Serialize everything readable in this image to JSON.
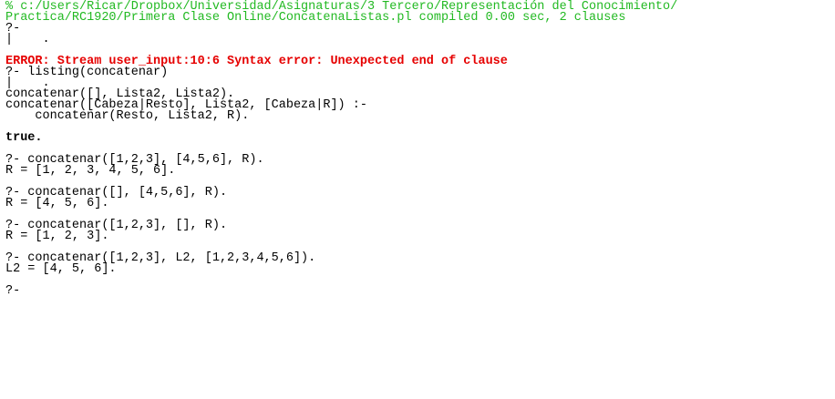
{
  "consult": {
    "line1": "% c:/Users/Ricar/Dropbox/Universidad/Asignaturas/3 Tercero/Representación del Conocimiento/",
    "line2": "Practica/RC1920/Primera Clase Online/ConcatenaListas.pl compiled 0.00 sec, 2 clauses"
  },
  "prompt": "?-",
  "cursor": "|    .",
  "error_line": "ERROR: Stream user_input:10:6 Syntax error: Unexpected end of clause",
  "listing": {
    "query": "?- listing(concatenar)",
    "cursor": "|    .",
    "clause1": "concatenar([], Lista2, Lista2).",
    "clause2_head": "concatenar([Cabeza|Resto], Lista2, [Cabeza|R]) :-",
    "clause2_body": "    concatenar(Resto, Lista2, R).",
    "result": "true."
  },
  "queries": [
    {
      "query": "?- concatenar([1,2,3], [4,5,6], R).",
      "answer": "R = [1, 2, 3, 4, 5, 6]."
    },
    {
      "query": "?- concatenar([], [4,5,6], R).",
      "answer": "R = [4, 5, 6]."
    },
    {
      "query": "?- concatenar([1,2,3], [], R).",
      "answer": "R = [1, 2, 3]."
    },
    {
      "query": "?- concatenar([1,2,3], L2, [1,2,3,4,5,6]).",
      "answer": "L2 = [4, 5, 6]."
    }
  ],
  "final_prompt": "?-"
}
